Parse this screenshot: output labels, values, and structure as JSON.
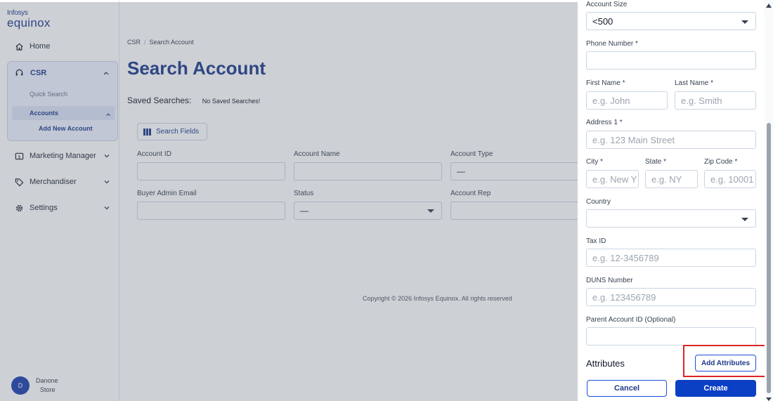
{
  "logo": {
    "line1": "Infosys",
    "line2": "equinox"
  },
  "sidebar": {
    "home": "Home",
    "csr": "CSR",
    "quick_search": "Quick Search",
    "accounts": "Accounts",
    "add_new_account": "Add New Account",
    "marketing_manager": "Marketing Manager",
    "merchandiser": "Merchandiser",
    "settings": "Settings"
  },
  "user": {
    "initial": "D",
    "name": "Danone",
    "role": "Store"
  },
  "breadcrumb": {
    "root": "CSR",
    "separator": "/",
    "current": "Search Account"
  },
  "page": {
    "title": "Search Account",
    "saved_label": "Saved Searches:",
    "saved_value": "No Saved Searches!",
    "search_fields_btn": "Search Fields",
    "copyright": "Copyright © 2026 Infosys Equinox. All rights reserved"
  },
  "search_form": {
    "account_id": "Account ID",
    "account_name": "Account Name",
    "account_type": "Account Type",
    "account_type_value": "—",
    "buyer_admin_email": "Buyer Admin Email",
    "status": "Status",
    "status_value": "—",
    "account_rep": "Account Rep"
  },
  "drawer": {
    "account_size_label": "Account Size",
    "account_size_value": "<500",
    "phone_label": "Phone Number *",
    "first_name_label": "First Name *",
    "first_name_ph": "e.g. John",
    "last_name_label": "Last Name *",
    "last_name_ph": "e.g. Smith",
    "address1_label": "Address 1 *",
    "address1_ph": "e.g. 123 Main Street",
    "city_label": "City *",
    "city_ph": "e.g. New Y",
    "state_label": "State *",
    "state_ph": "e.g. NY",
    "zip_label": "Zip Code *",
    "zip_ph": "e.g. 10001",
    "country_label": "Country",
    "taxid_label": "Tax ID",
    "taxid_ph": "e.g. 12-3456789",
    "duns_label": "DUNS Number",
    "duns_ph": "e.g. 123456789",
    "parent_label": "Parent Account ID (Optional)",
    "attributes_label": "Attributes",
    "add_attributes_btn": "Add Attributes",
    "cancel_btn": "Cancel",
    "create_btn": "Create"
  },
  "colors": {
    "brand": "#1e3a8a",
    "primary_button": "#0b3fc4",
    "highlight": "#dc2626"
  }
}
